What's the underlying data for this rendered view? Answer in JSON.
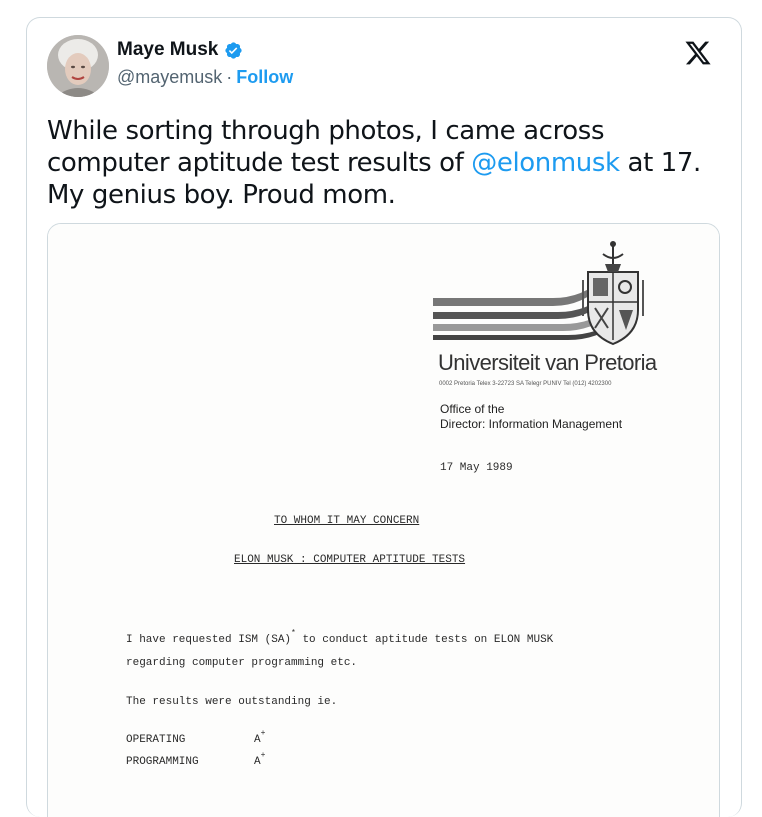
{
  "tweet": {
    "display_name": "Maye Musk",
    "handle": "@mayemusk",
    "separator": "·",
    "follow_label": "Follow",
    "text_before": "While sorting through photos, I came across computer aptitude test results of ",
    "mention": "@elonmusk",
    "text_after": " at 17. My genius boy. Proud mom."
  },
  "document": {
    "university": "Universiteit van Pretoria",
    "address": "0002 Pretoria  Telex 3-22723 SA  Telegr PUNIV  Tel (012) 4202300",
    "office_line1": "Office of the",
    "office_line2": "Director: Information Management",
    "date": "17 May 1989",
    "heading1": "TO WHOM IT MAY CONCERN",
    "heading2": "ELON MUSK : COMPUTER APTITUDE TESTS",
    "para1_a": "I have requested ISM (SA)",
    "para1_star": "*",
    "para1_b": " to conduct aptitude tests on ELON MUSK",
    "para1_line2": "regarding computer programming etc.",
    "para2": "The results were outstanding ie.",
    "results": [
      {
        "label": "OPERATING",
        "grade": "A",
        "sup": "+"
      },
      {
        "label": "PROGRAMMING",
        "grade": "A",
        "sup": "+"
      }
    ]
  },
  "colors": {
    "accent": "#1d9bf0",
    "text": "#0f1419",
    "muted": "#536471",
    "border": "#cfd9de"
  },
  "icons": {
    "verified": "verified-badge-icon",
    "brand": "x-logo-icon"
  }
}
